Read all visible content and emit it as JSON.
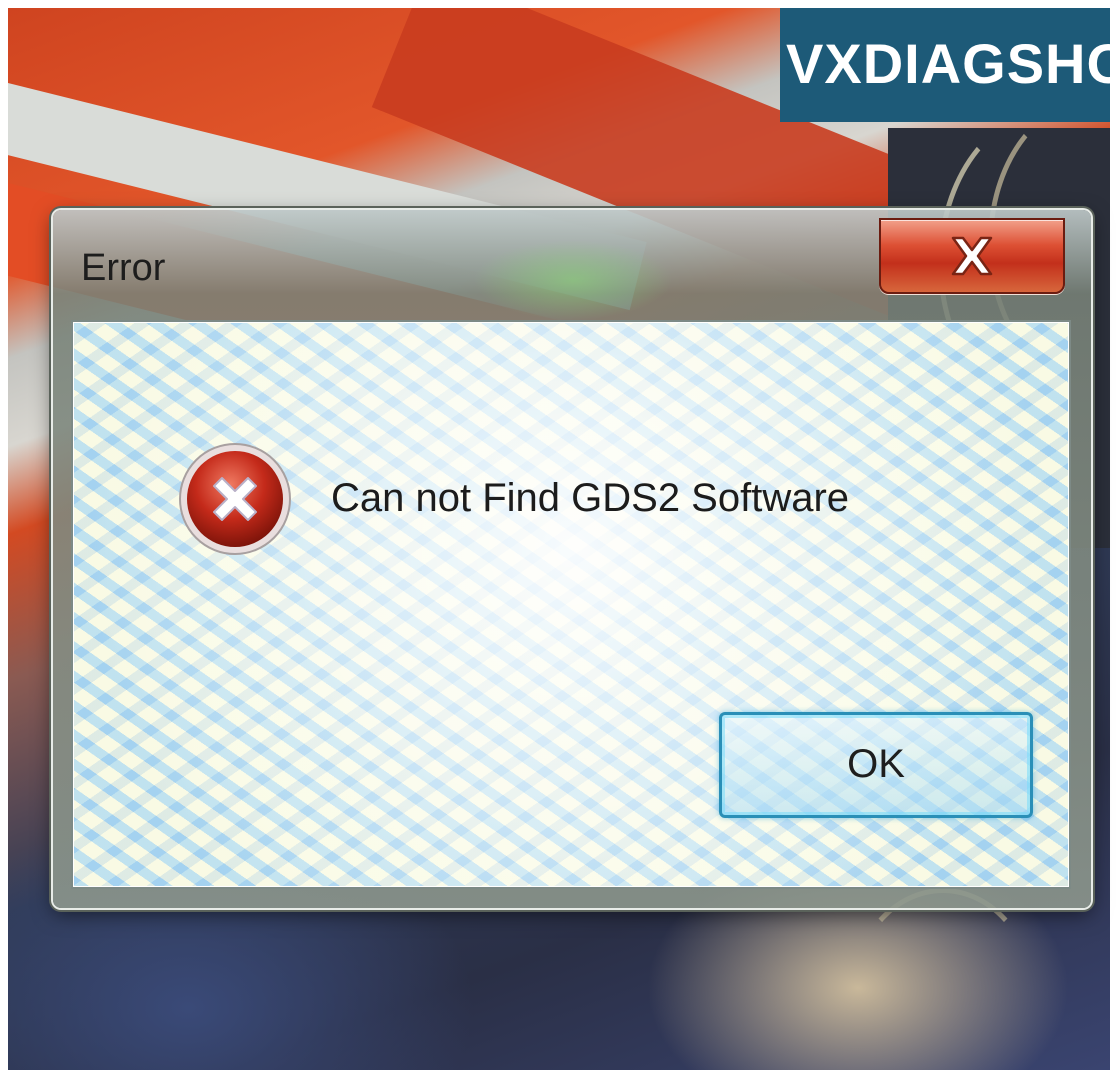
{
  "watermark": {
    "text": "VXDIAGSHO",
    "background_color": "#1d5a78"
  },
  "dialog": {
    "title": "Error",
    "close_icon": "close-icon",
    "message_icon": "error-icon",
    "message": "Can not Find GDS2 Software",
    "ok_label": "OK"
  },
  "colors": {
    "close_button_red": "#c3301b",
    "error_icon_red": "#c42a1a",
    "ok_focus_border": "#2a8fb7"
  }
}
